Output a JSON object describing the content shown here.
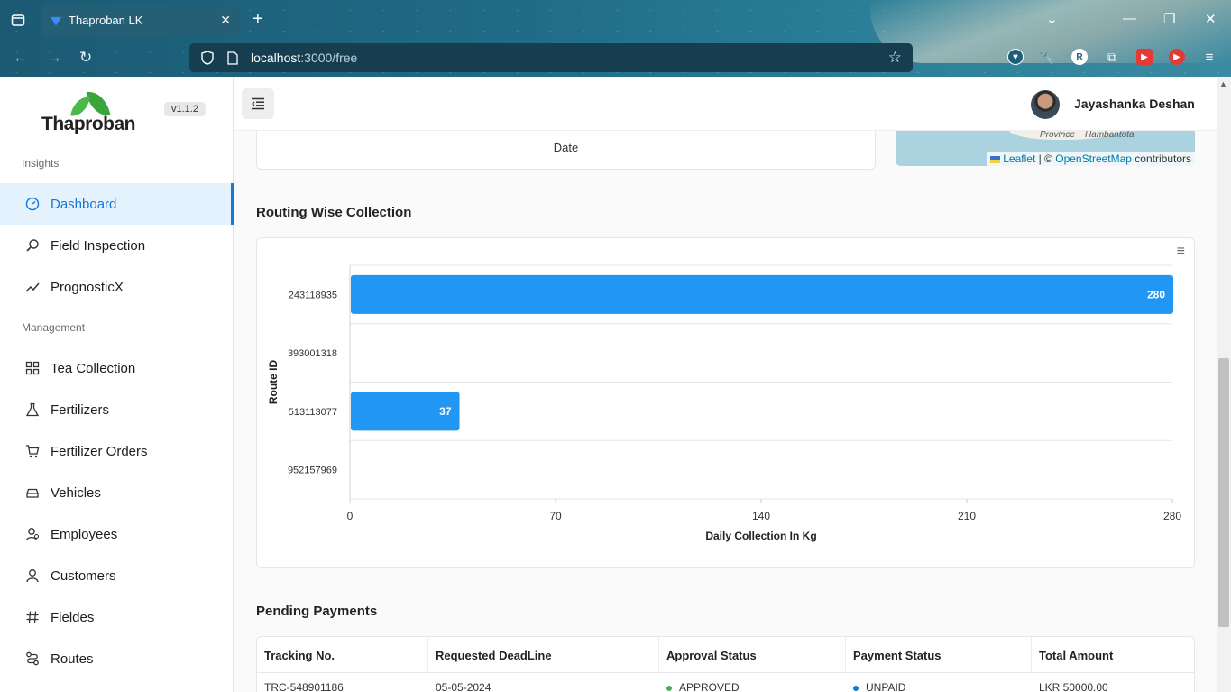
{
  "browser": {
    "tab_title": "Thaproban LK",
    "url_host": "localhost",
    "url_path": ":3000/free"
  },
  "sidebar": {
    "logo_text": "Thaproban",
    "version": "v1.1.2",
    "sections": {
      "insights": "Insights",
      "management": "Management"
    },
    "items": [
      {
        "label": "Dashboard",
        "icon": "dashboard-icon",
        "active": true
      },
      {
        "label": "Field Inspection",
        "icon": "search-icon",
        "active": false
      },
      {
        "label": "PrognosticX",
        "icon": "trend-icon",
        "active": false
      },
      {
        "label": "Tea Collection",
        "icon": "grid-icon",
        "active": false
      },
      {
        "label": "Fertilizers",
        "icon": "flask-icon",
        "active": false
      },
      {
        "label": "Fertilizer Orders",
        "icon": "cart-icon",
        "active": false
      },
      {
        "label": "Vehicles",
        "icon": "car-icon",
        "active": false
      },
      {
        "label": "Employees",
        "icon": "employees-icon",
        "active": false
      },
      {
        "label": "Customers",
        "icon": "user-icon",
        "active": false
      },
      {
        "label": "Fieldes",
        "icon": "hash-icon",
        "active": false
      },
      {
        "label": "Routes",
        "icon": "route-icon",
        "active": false
      }
    ]
  },
  "header": {
    "user_name": "Jayashanka Deshan"
  },
  "previous_chart": {
    "xlabel": "Date"
  },
  "map": {
    "label_1": "Province",
    "label_2": "Hambantota",
    "attribution_leaflet": "Leaflet",
    "attribution_sep": " | © ",
    "attribution_osm": "OpenStreetMap",
    "attribution_tail": " contributors"
  },
  "routing": {
    "title": "Routing Wise Collection"
  },
  "chart_data": {
    "type": "bar",
    "orientation": "horizontal",
    "categories": [
      "243118935",
      "393001318",
      "513113077",
      "952157969"
    ],
    "values": [
      280,
      0,
      37,
      0
    ],
    "data_labels": [
      "280",
      "",
      "37",
      ""
    ],
    "xlabel": "Daily Collection In Kg",
    "ylabel": "Route ID",
    "xlim": [
      0,
      280
    ],
    "xticks": [
      0,
      70,
      140,
      210,
      280
    ],
    "bar_color": "#2196f3",
    "grid": true
  },
  "payments": {
    "title": "Pending Payments",
    "columns": [
      "Tracking No.",
      "Requested DeadLine",
      "Approval Status",
      "Payment Status",
      "Total Amount"
    ],
    "rows": [
      {
        "tracking": "TRC-548901186",
        "deadline": "05-05-2024",
        "approval": "APPROVED",
        "payment": "UNPAID",
        "amount": "LKR 50000.00"
      }
    ],
    "status_colors": {
      "approved": "#4caf50",
      "unpaid": "#1976d2"
    }
  }
}
